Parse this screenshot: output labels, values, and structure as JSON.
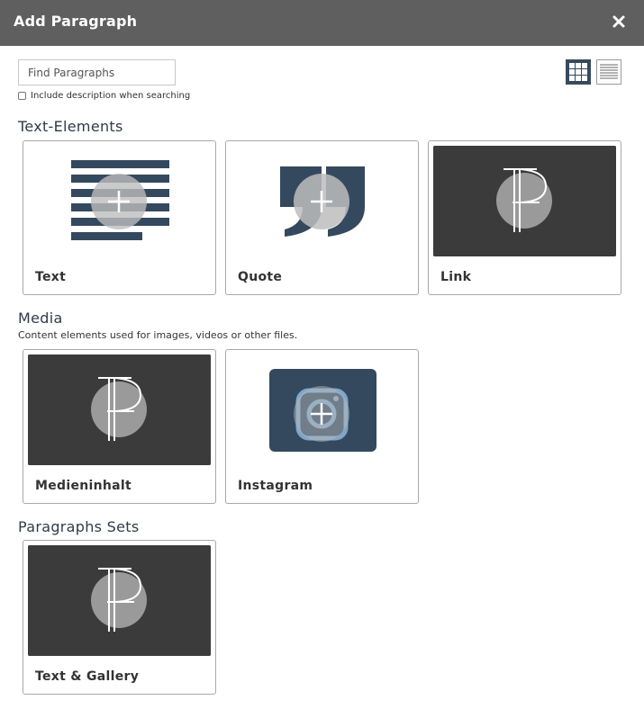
{
  "dialog": {
    "title": "Add Paragraph",
    "close_icon": "close-icon"
  },
  "search": {
    "placeholder": "Find Paragraphs",
    "value": "",
    "include_description_label": "Include description when searching",
    "include_description_checked": false
  },
  "view_toggle": {
    "grid_icon": "grid-view-icon",
    "list_icon": "list-view-icon",
    "active": "grid"
  },
  "sections": [
    {
      "title": "Text-Elements",
      "description": "",
      "items": [
        {
          "label": "Text",
          "icon": "text-lines-icon"
        },
        {
          "label": "Quote",
          "icon": "quote-icon"
        },
        {
          "label": "Link",
          "icon": "paragraph-icon"
        }
      ]
    },
    {
      "title": "Media",
      "description": "Content elements used for images, videos or other files.",
      "items": [
        {
          "label": "Medieninhalt",
          "icon": "paragraph-icon"
        },
        {
          "label": "Instagram",
          "icon": "instagram-icon"
        }
      ]
    },
    {
      "title": "Paragraphs Sets",
      "description": "",
      "items": [
        {
          "label": "Text & Gallery",
          "icon": "paragraph-icon"
        }
      ]
    }
  ],
  "colors": {
    "titlebar": "#5f5f5f",
    "accent_dark": "#34495e",
    "thumb_dark": "#3b3b3b",
    "overlay": "#999999"
  }
}
